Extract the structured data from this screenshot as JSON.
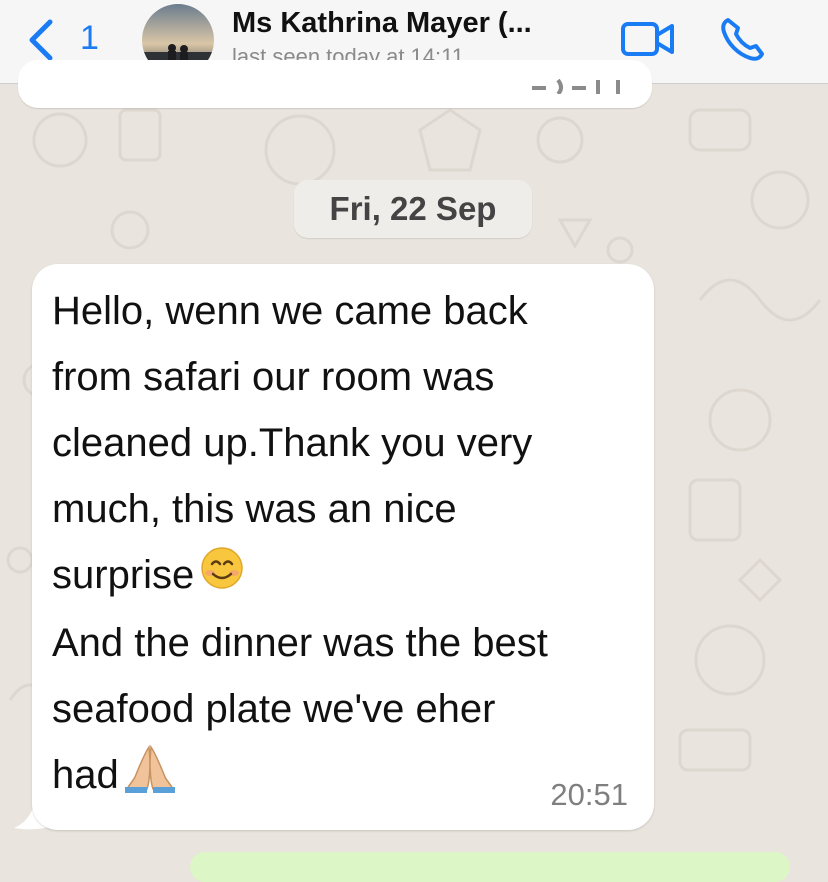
{
  "header": {
    "back_count": "1",
    "contact_name": "Ms Kathrina Mayer (...",
    "last_seen": "last seen today at 14:11",
    "accent_color": "#1a7cf5",
    "icons": [
      "chevron-left-icon",
      "video-call-icon",
      "phone-icon"
    ]
  },
  "chat": {
    "date_separator": "Fri, 22 Sep",
    "message": {
      "line1": "Hello, wenn we came back\nfrom safari our room was\ncleaned up.Thank you very\nmuch, this was an nice\nsurprise",
      "line2": "And the dinner was the best\nseafood plate we've eher\nhad",
      "emoji_1": "smiling-face-icon",
      "emoji_2": "folded-hands-icon",
      "time": "20:51"
    }
  },
  "colors": {
    "wallpaper": "#e9e4dd",
    "incoming_bubble": "#ffffff",
    "outgoing_bubble": "#dcf7c5"
  }
}
